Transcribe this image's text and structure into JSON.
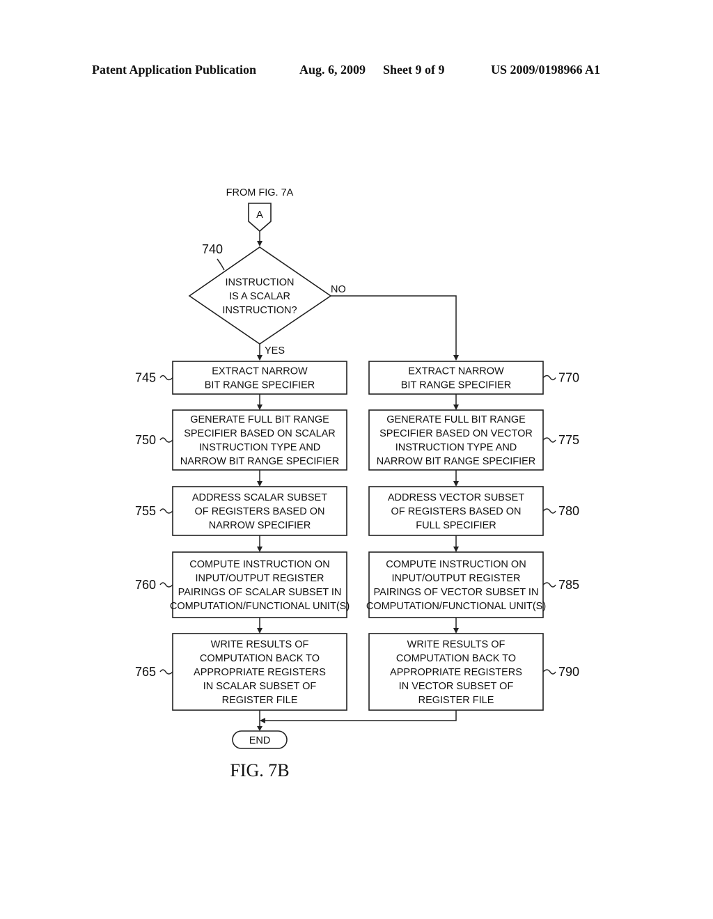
{
  "header": {
    "publication": "Patent Application Publication",
    "date": "Aug. 6, 2009",
    "sheet": "Sheet 9 of 9",
    "number": "US 2009/0198966 A1"
  },
  "diagram": {
    "from_label": "FROM FIG. 7A",
    "connector": "A",
    "decision": {
      "ref": "740",
      "lines": [
        "INSTRUCTION",
        "IS A SCALAR",
        "INSTRUCTION?"
      ],
      "yes": "YES",
      "no": "NO"
    },
    "left_steps": [
      {
        "ref": "745",
        "lines": [
          "EXTRACT NARROW",
          "BIT RANGE SPECIFIER"
        ]
      },
      {
        "ref": "750",
        "lines": [
          "GENERATE FULL BIT RANGE",
          "SPECIFIER BASED ON SCALAR",
          "INSTRUCTION TYPE AND",
          "NARROW BIT RANGE SPECIFIER"
        ]
      },
      {
        "ref": "755",
        "lines": [
          "ADDRESS SCALAR SUBSET",
          "OF REGISTERS BASED ON",
          "NARROW SPECIFIER"
        ]
      },
      {
        "ref": "760",
        "lines": [
          "COMPUTE INSTRUCTION ON",
          "INPUT/OUTPUT REGISTER",
          "PAIRINGS OF SCALAR SUBSET IN",
          "COMPUTATION/FUNCTIONAL UNIT(S)"
        ]
      },
      {
        "ref": "765",
        "lines": [
          "WRITE RESULTS OF",
          "COMPUTATION BACK TO",
          "APPROPRIATE REGISTERS",
          "IN SCALAR SUBSET OF",
          "REGISTER FILE"
        ]
      }
    ],
    "right_steps": [
      {
        "ref": "770",
        "lines": [
          "EXTRACT NARROW",
          "BIT RANGE SPECIFIER"
        ]
      },
      {
        "ref": "775",
        "lines": [
          "GENERATE FULL BIT RANGE",
          "SPECIFIER BASED ON VECTOR",
          "INSTRUCTION TYPE AND",
          "NARROW BIT RANGE SPECIFIER"
        ]
      },
      {
        "ref": "780",
        "lines": [
          "ADDRESS VECTOR SUBSET",
          "OF REGISTERS BASED ON",
          "FULL SPECIFIER"
        ]
      },
      {
        "ref": "785",
        "lines": [
          "COMPUTE INSTRUCTION ON",
          "INPUT/OUTPUT REGISTER",
          "PAIRINGS OF VECTOR SUBSET IN",
          "COMPUTATION/FUNCTIONAL UNIT(S)"
        ]
      },
      {
        "ref": "790",
        "lines": [
          "WRITE RESULTS OF",
          "COMPUTATION BACK TO",
          "APPROPRIATE REGISTERS",
          "IN VECTOR SUBSET OF",
          "REGISTER FILE"
        ]
      }
    ],
    "end_label": "END",
    "figure_caption": "FIG. 7B"
  }
}
